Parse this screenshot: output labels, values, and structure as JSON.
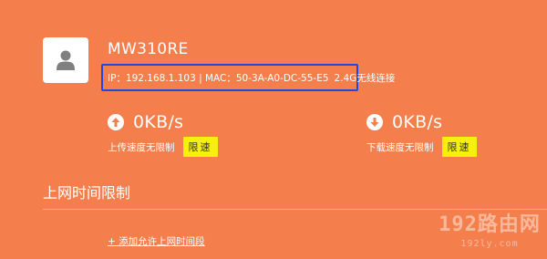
{
  "device": {
    "name": "MW310RE",
    "info": "IP：192.168.1.103 | MAC：50-3A-A0-DC-55-E5",
    "connection": "2.4G无线连接",
    "avatar_icon": "user-icon"
  },
  "upload": {
    "value": "0KB/s",
    "label": "上传速度无限制",
    "button": "限速",
    "icon": "arrow-up-circle-icon"
  },
  "download": {
    "value": "0KB/s",
    "label": "下载速度无限制",
    "button": "限速",
    "icon": "arrow-down-circle-icon"
  },
  "section": {
    "title": "上网时间限制",
    "add_link": "+ 添加允许上网时间段"
  },
  "watermark": {
    "main": "192路由网",
    "sub": "192ly.com"
  },
  "colors": {
    "background": "#f47f4c",
    "highlight_border": "#2046e6",
    "limit_button": "#f7f00a"
  }
}
